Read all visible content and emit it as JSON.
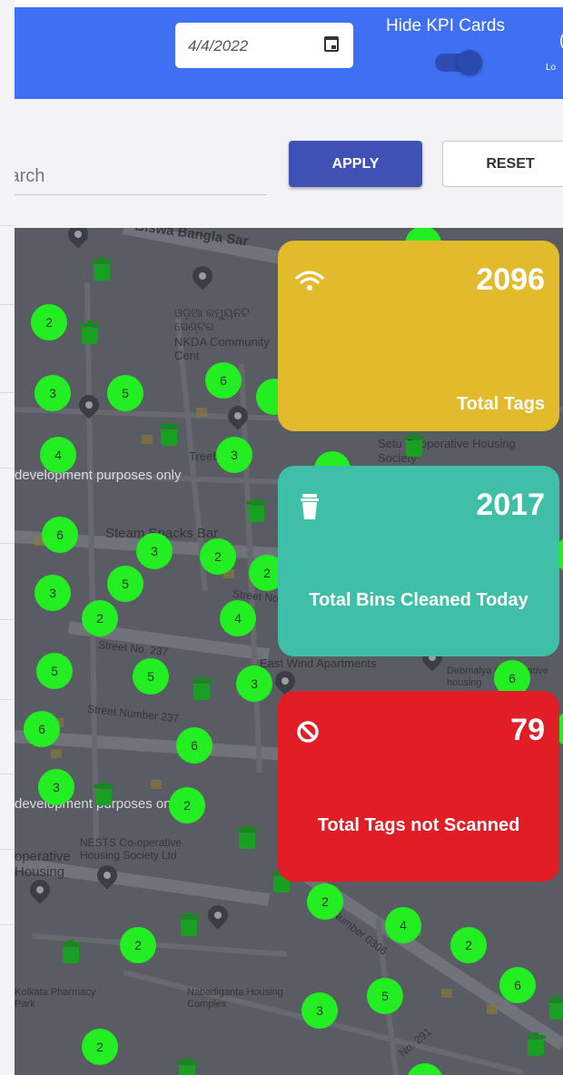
{
  "header": {
    "date_value": "4/4/2022",
    "hide_kpi_label": "Hide KPI Cards",
    "hide_kpi_on": true,
    "edge_glyph": "(",
    "edge_small_text": "Lo"
  },
  "filters": {
    "search_placeholder": "Search",
    "apply_label": "APPLY",
    "reset_label": "RESET"
  },
  "kpi": {
    "tags": {
      "icon": "wifi-icon",
      "value": "2096",
      "label": "Total Tags",
      "color": "#e2bb2c"
    },
    "cleaned": {
      "icon": "trash-icon",
      "value": "2017",
      "label": "Total Bins Cleaned Today",
      "color": "#40bfa8"
    },
    "unscanned": {
      "icon": "block-icon",
      "value": "79",
      "label": "Total Tags not Scanned",
      "color": "#e11d26"
    }
  },
  "map": {
    "labels": {
      "biswa_bangla": "Biswa Bangla Sar",
      "nkda_odia": "ଓଡ଼ିଆ କମ୍ୟୁନିଟି ସେଣ୍ଟର",
      "nkda": "NKDA Community Cent",
      "treebo": "Treebo",
      "dev_purposes_1": "development purposes only",
      "dev_purposes_2": "development purposes only",
      "steam_snacks": "Steam Snacks Bar",
      "street_237_a": "Street No. 237",
      "street_237_b": "Street Number 237",
      "east_wind": "East Wind Apartments",
      "nests": "NESTS Co-operative Housing Society Ltd",
      "coop_housing": "operative Housing",
      "setu_coop": "Setu Cooperative Housing Society",
      "debmalya": "Debmalya Cooperative housing",
      "street_0306": "Street Number 0306",
      "pharmacy": "Kolkata Pharmacy Park",
      "nabadiganta": "Nabadiganta Housing Complex",
      "no_291": "No. 291"
    },
    "cluster_counts": [
      "2",
      "3",
      "5",
      "6",
      "4",
      "3",
      "6",
      "3",
      "2",
      "5",
      "3",
      "2",
      "4",
      "2",
      "5",
      "5",
      "3",
      "6",
      "6",
      "3",
      "2",
      "2",
      "4",
      "2",
      "2",
      "3",
      "5",
      "6",
      "2",
      "6"
    ]
  }
}
